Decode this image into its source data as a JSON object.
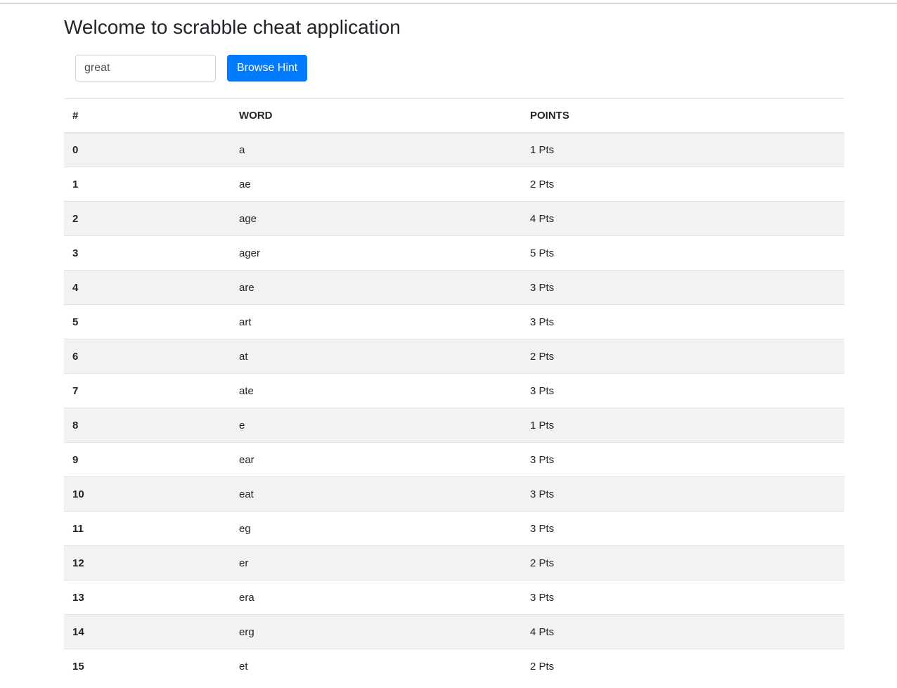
{
  "page": {
    "title": "Welcome to scrabble cheat application"
  },
  "search": {
    "value": "great",
    "button_label": "Browse Hint"
  },
  "table": {
    "headers": [
      "#",
      "WORD",
      "POINTS"
    ],
    "rows": [
      {
        "index": "0",
        "word": "a",
        "points": "1 Pts"
      },
      {
        "index": "1",
        "word": "ae",
        "points": "2 Pts"
      },
      {
        "index": "2",
        "word": "age",
        "points": "4 Pts"
      },
      {
        "index": "3",
        "word": "ager",
        "points": "5 Pts"
      },
      {
        "index": "4",
        "word": "are",
        "points": "3 Pts"
      },
      {
        "index": "5",
        "word": "art",
        "points": "3 Pts"
      },
      {
        "index": "6",
        "word": "at",
        "points": "2 Pts"
      },
      {
        "index": "7",
        "word": "ate",
        "points": "3 Pts"
      },
      {
        "index": "8",
        "word": "e",
        "points": "1 Pts"
      },
      {
        "index": "9",
        "word": "ear",
        "points": "3 Pts"
      },
      {
        "index": "10",
        "word": "eat",
        "points": "3 Pts"
      },
      {
        "index": "11",
        "word": "eg",
        "points": "3 Pts"
      },
      {
        "index": "12",
        "word": "er",
        "points": "2 Pts"
      },
      {
        "index": "13",
        "word": "era",
        "points": "3 Pts"
      },
      {
        "index": "14",
        "word": "erg",
        "points": "4 Pts"
      },
      {
        "index": "15",
        "word": "et",
        "points": "2 Pts"
      }
    ]
  },
  "colors": {
    "primary": "#007bff",
    "stripe": "#f2f2f2",
    "border": "#dee2e6"
  }
}
